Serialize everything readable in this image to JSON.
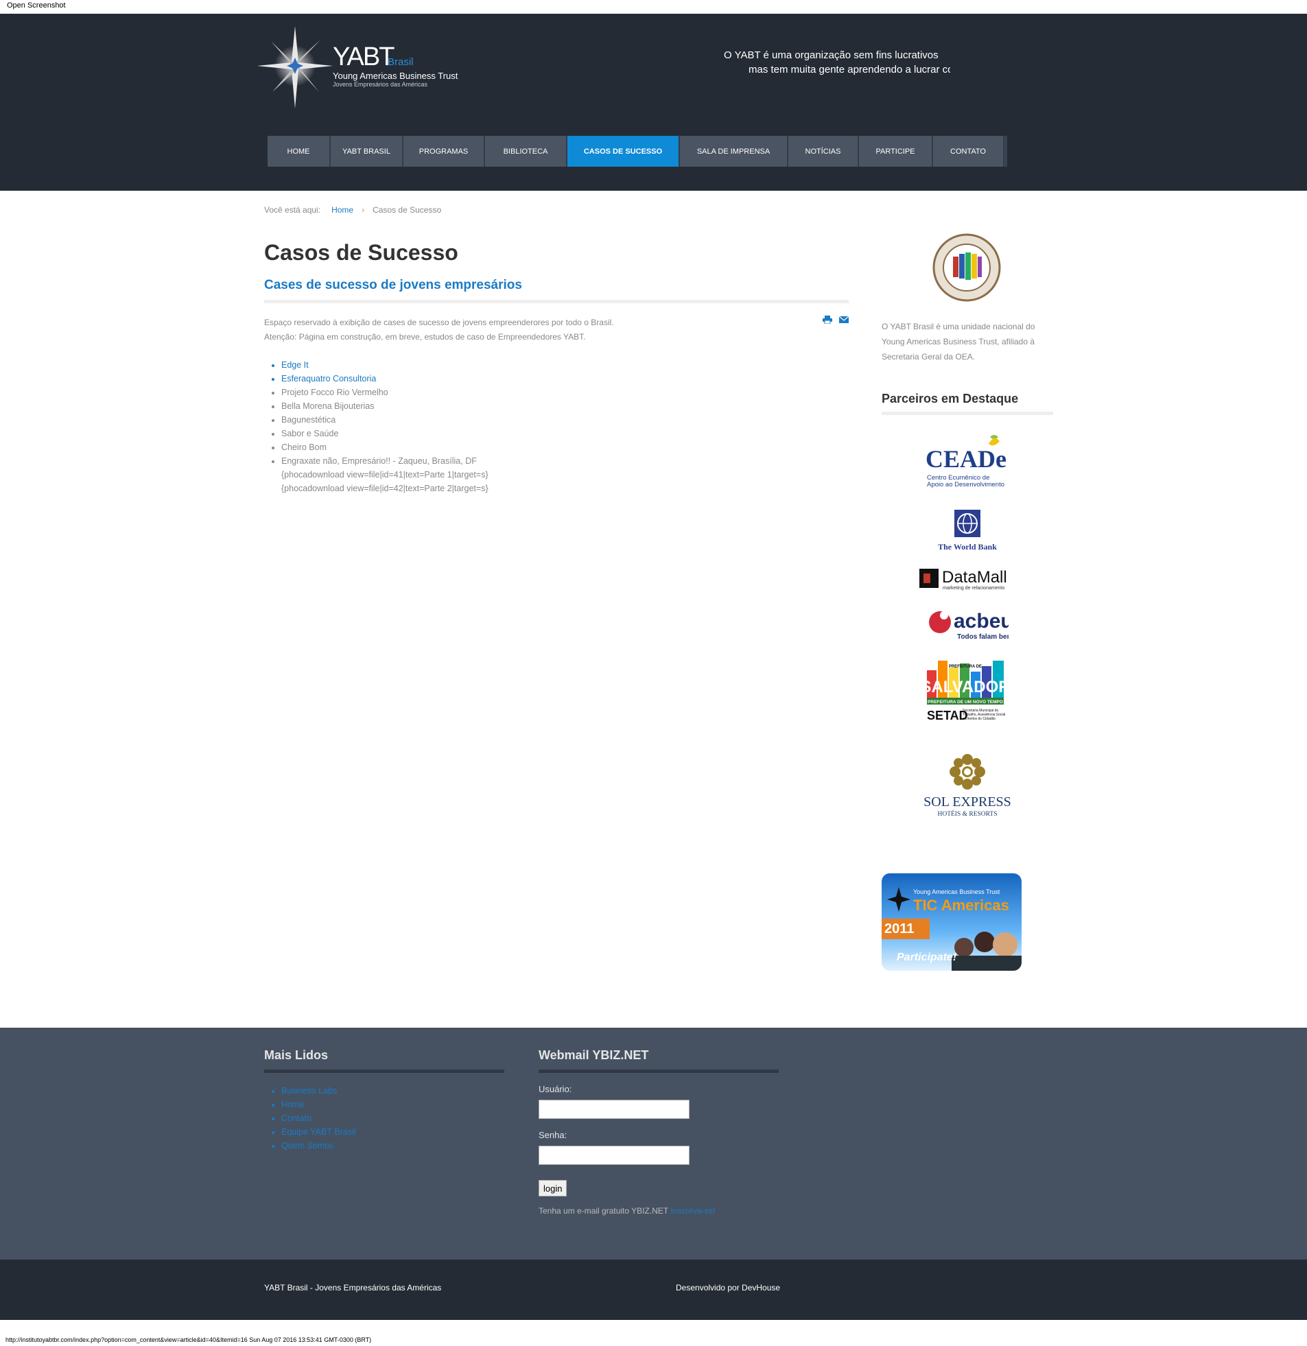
{
  "window": {
    "label": "Open Screenshot"
  },
  "header": {
    "logo_name": "YABT",
    "logo_brasil": "Brasil",
    "logo_sub1": "Young Americas Business Trust",
    "logo_sub2": "Jovens Empresários das Américas",
    "tagline_line1": "O YABT é uma organização sem fins lucrativos",
    "tagline_line2": "mas tem muita gente aprendendo a lucrar co"
  },
  "nav": [
    {
      "label": "Home"
    },
    {
      "label": "YABT Brasil"
    },
    {
      "label": "Programas"
    },
    {
      "label": "Biblioteca"
    },
    {
      "label": "Casos de Sucesso"
    },
    {
      "label": "Sala de Imprensa"
    },
    {
      "label": "Notícias"
    },
    {
      "label": "Participe"
    },
    {
      "label": "Contato"
    }
  ],
  "breadcrumb": {
    "prefix": "Você está aqui:",
    "home": "Home",
    "current": "Casos de Sucesso"
  },
  "article": {
    "title": "Casos de Sucesso",
    "subtitle": "Cases de sucesso de jovens empresários",
    "intro1": "Espaço reservado à exibição de cases de sucesso de jovens empreenderores por todo o Brasil.",
    "intro2": "Atenção: Página em construção, em breve, estudos de caso de Empreendedores YABT.",
    "cases": [
      "Edge It",
      "Esferaquatro Consultoria",
      "Projeto Focco Rio Vermelho",
      "Bella Morena Bijouterias",
      "Bagunestética",
      "Sabor e Saúde",
      "Cheiro Bom",
      "Engraxate não, Empresário!! - Zaqueu, Brasília, DF"
    ],
    "extra1": "{phocadownload view=file|id=41|text=Parte 1|target=s}",
    "extra2": "{phocadownload view=file|id=42|text=Parte 2|target=s}"
  },
  "sidebar": {
    "about": "O YABT Brasil é uma unidade nacional do Young Americas Business Trust, afiliado à Secretaria Geral da OEA.",
    "partners_heading": "Parceiros em Destaque",
    "ceade_name": "CEADe",
    "ceade_sub1": "Centro Ecumênico de",
    "ceade_sub2": "Apoio ao Desenvolvimento",
    "worldbank": "The World Bank",
    "datamall": "DataMall",
    "datamall_sub": "marketing de relacionamento",
    "acbeu": "acbeu",
    "acbeu_sub": "Todos falam bem",
    "salvador_top": "PREFEITURA DE",
    "salvador": "SALVADOR",
    "salvador_band": "PREFEITURA DE UM NOVO TEMPO",
    "setad": "SETAD",
    "setad_sub": "Secretaria Municipal do Trabalho, Assistência Social e Direitos do Cidadão",
    "sol": "SOL EXPRESS",
    "sol_sub": "HOTÉIS & RESORTS",
    "tic_top": "Young Americas Business Trust",
    "tic_title": "TIC Americas",
    "tic_year": "2011",
    "tic_cta": "Participate!"
  },
  "footer": {
    "col1_heading": "Mais Lidos",
    "col1_links": [
      "Business Labs",
      "Home",
      "Contato",
      "Equipe YABT Brasil",
      "Quem Somos"
    ],
    "col2_heading": "Webmail YBIZ.NET",
    "user_label": "Usuário:",
    "pass_label": "Senha:",
    "login": "login",
    "note": "Tenha um e-mail gratuito YBIZ.NET",
    "note_link": "Inscreva-se!"
  },
  "bottom": {
    "left": "YABT Brasil - Jovens Empresários das Américas",
    "right": "Desenvolvido por DevHouse"
  },
  "status": "http://institutoyabtbr.com/index.php?option=com_content&view=article&id=40&Itemid=16 Sun Aug 07 2016 13:53:41 GMT-0300 (BRT)",
  "colors": {
    "header_bg": "#252b35",
    "accent": "#0e8ad6",
    "footer_bg": "#465262"
  }
}
